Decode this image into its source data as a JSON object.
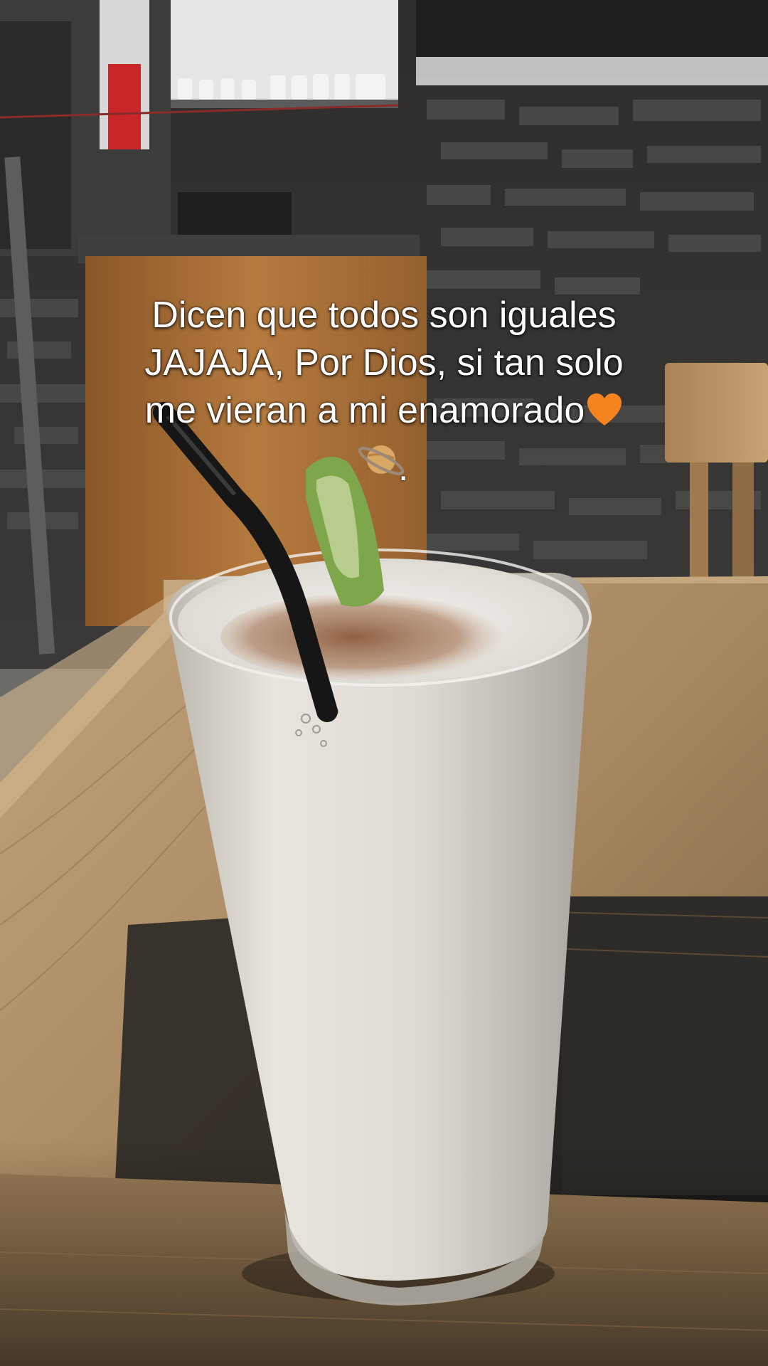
{
  "caption": {
    "line1": "Dicen que todos son iguales",
    "line2": "JAJAJA, Por Dios, si tan solo",
    "line3": "me vieran a mi enamorado",
    "trailing_emoji": "orange-heart-emoji",
    "planet_emoji": "ringed-planet-emoji",
    "end_mark": "."
  },
  "colors": {
    "caption_text": "#ffffff",
    "heart": "#f5831f",
    "drink": "#e9e6df",
    "table_wood": "#b99a6e",
    "brick_wall": "#3a3a3a",
    "cabinet": "#b9793a"
  },
  "scene": {
    "subject": "tall glass of foamy white drink with cinnamon, black straw and lime peel",
    "setting": "wooden table in a café with dark brick wall and chairs"
  }
}
